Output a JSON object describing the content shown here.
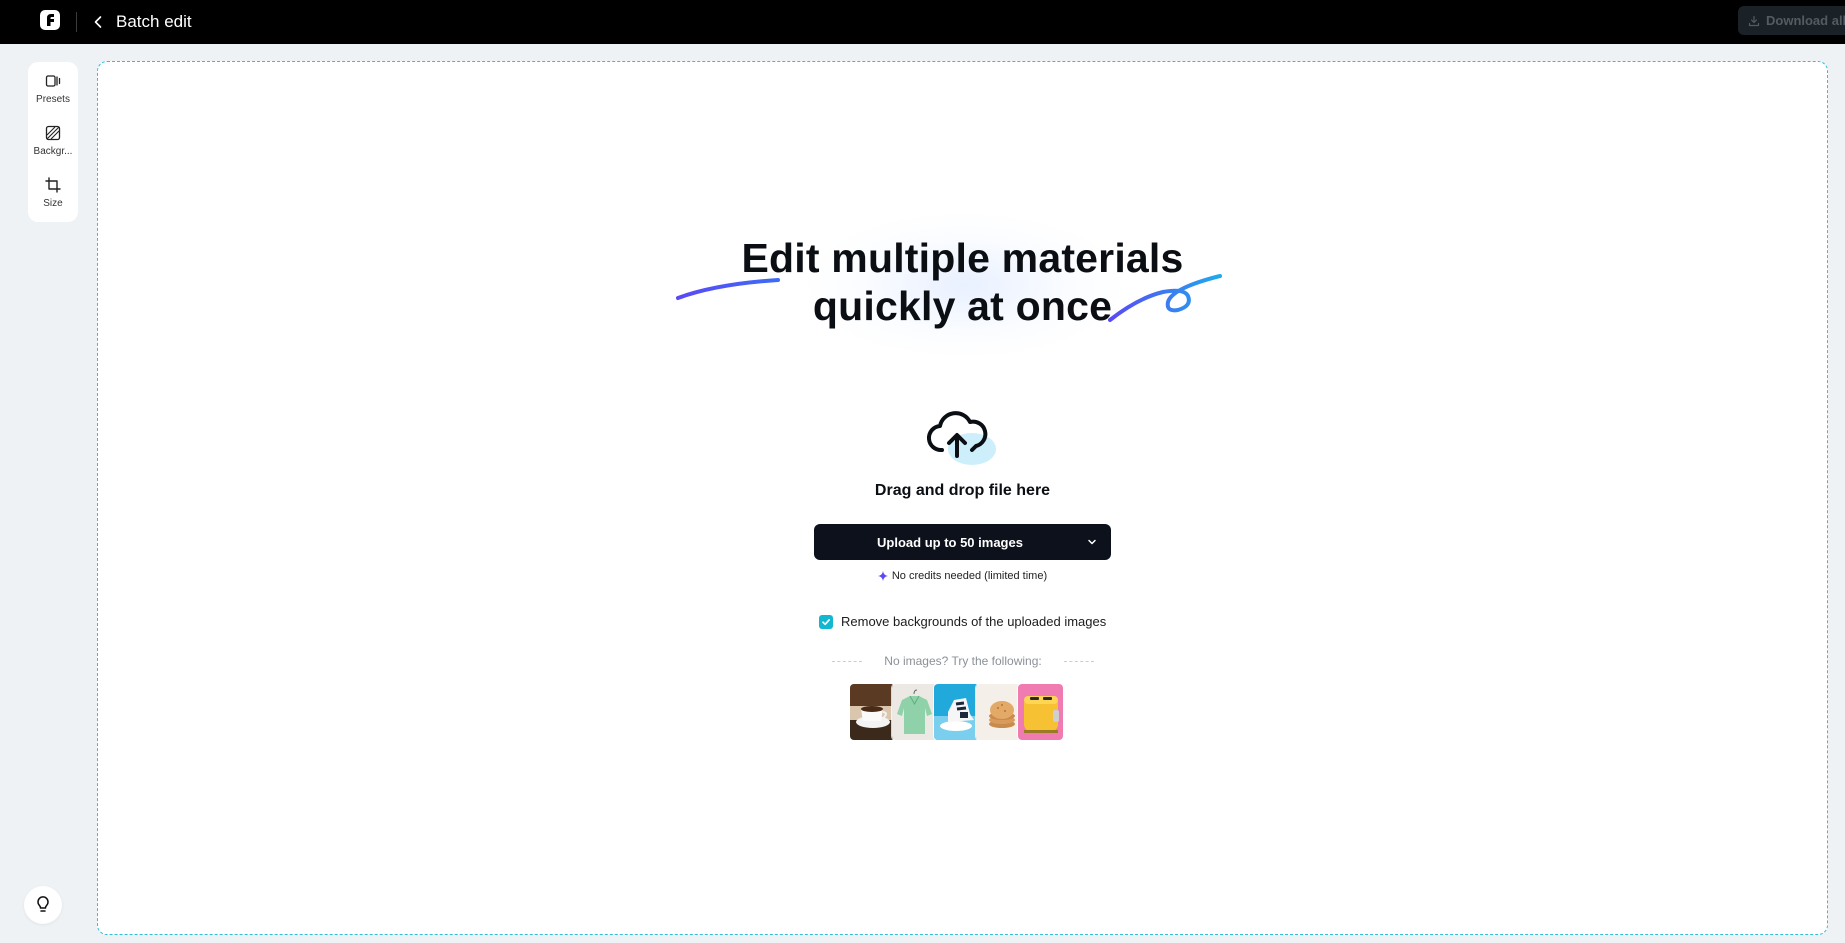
{
  "header": {
    "title": "Batch edit",
    "download_label": "Download all"
  },
  "tools": [
    {
      "label": "Presets",
      "icon": "presets-icon"
    },
    {
      "label": "Backgr...",
      "icon": "background-icon"
    },
    {
      "label": "Size",
      "icon": "crop-icon"
    }
  ],
  "main": {
    "headline_line1": "Edit multiple materials",
    "headline_line2": "quickly at once",
    "drag_text": "Drag and drop file here",
    "upload_label": "Upload up to 50 images",
    "credits_text": "No credits needed (limited time)",
    "remove_bg_label": "Remove backgrounds of the uploaded images",
    "remove_bg_checked": true,
    "try_text": "No images? Try the following:",
    "samples": [
      {
        "icon": "coffee-cup-sample"
      },
      {
        "icon": "green-shirt-sample"
      },
      {
        "icon": "sneaker-sample"
      },
      {
        "icon": "cookies-sample"
      },
      {
        "icon": "yellow-toaster-sample"
      }
    ]
  },
  "colors": {
    "accent": "#14b7d0",
    "topbar": "#000000",
    "button_dark": "#0c111b",
    "dropzone_border": "#31bfd6"
  }
}
